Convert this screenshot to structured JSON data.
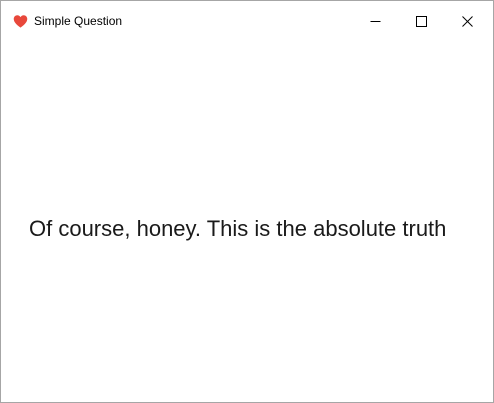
{
  "window": {
    "title": "Simple Question",
    "icon": "heart-icon",
    "icon_color": "#e8483b"
  },
  "controls": {
    "minimize_icon": "minimize-icon",
    "maximize_icon": "maximize-icon",
    "close_icon": "close-icon"
  },
  "content": {
    "message": "Of course, honey. This is the absolute truth"
  }
}
